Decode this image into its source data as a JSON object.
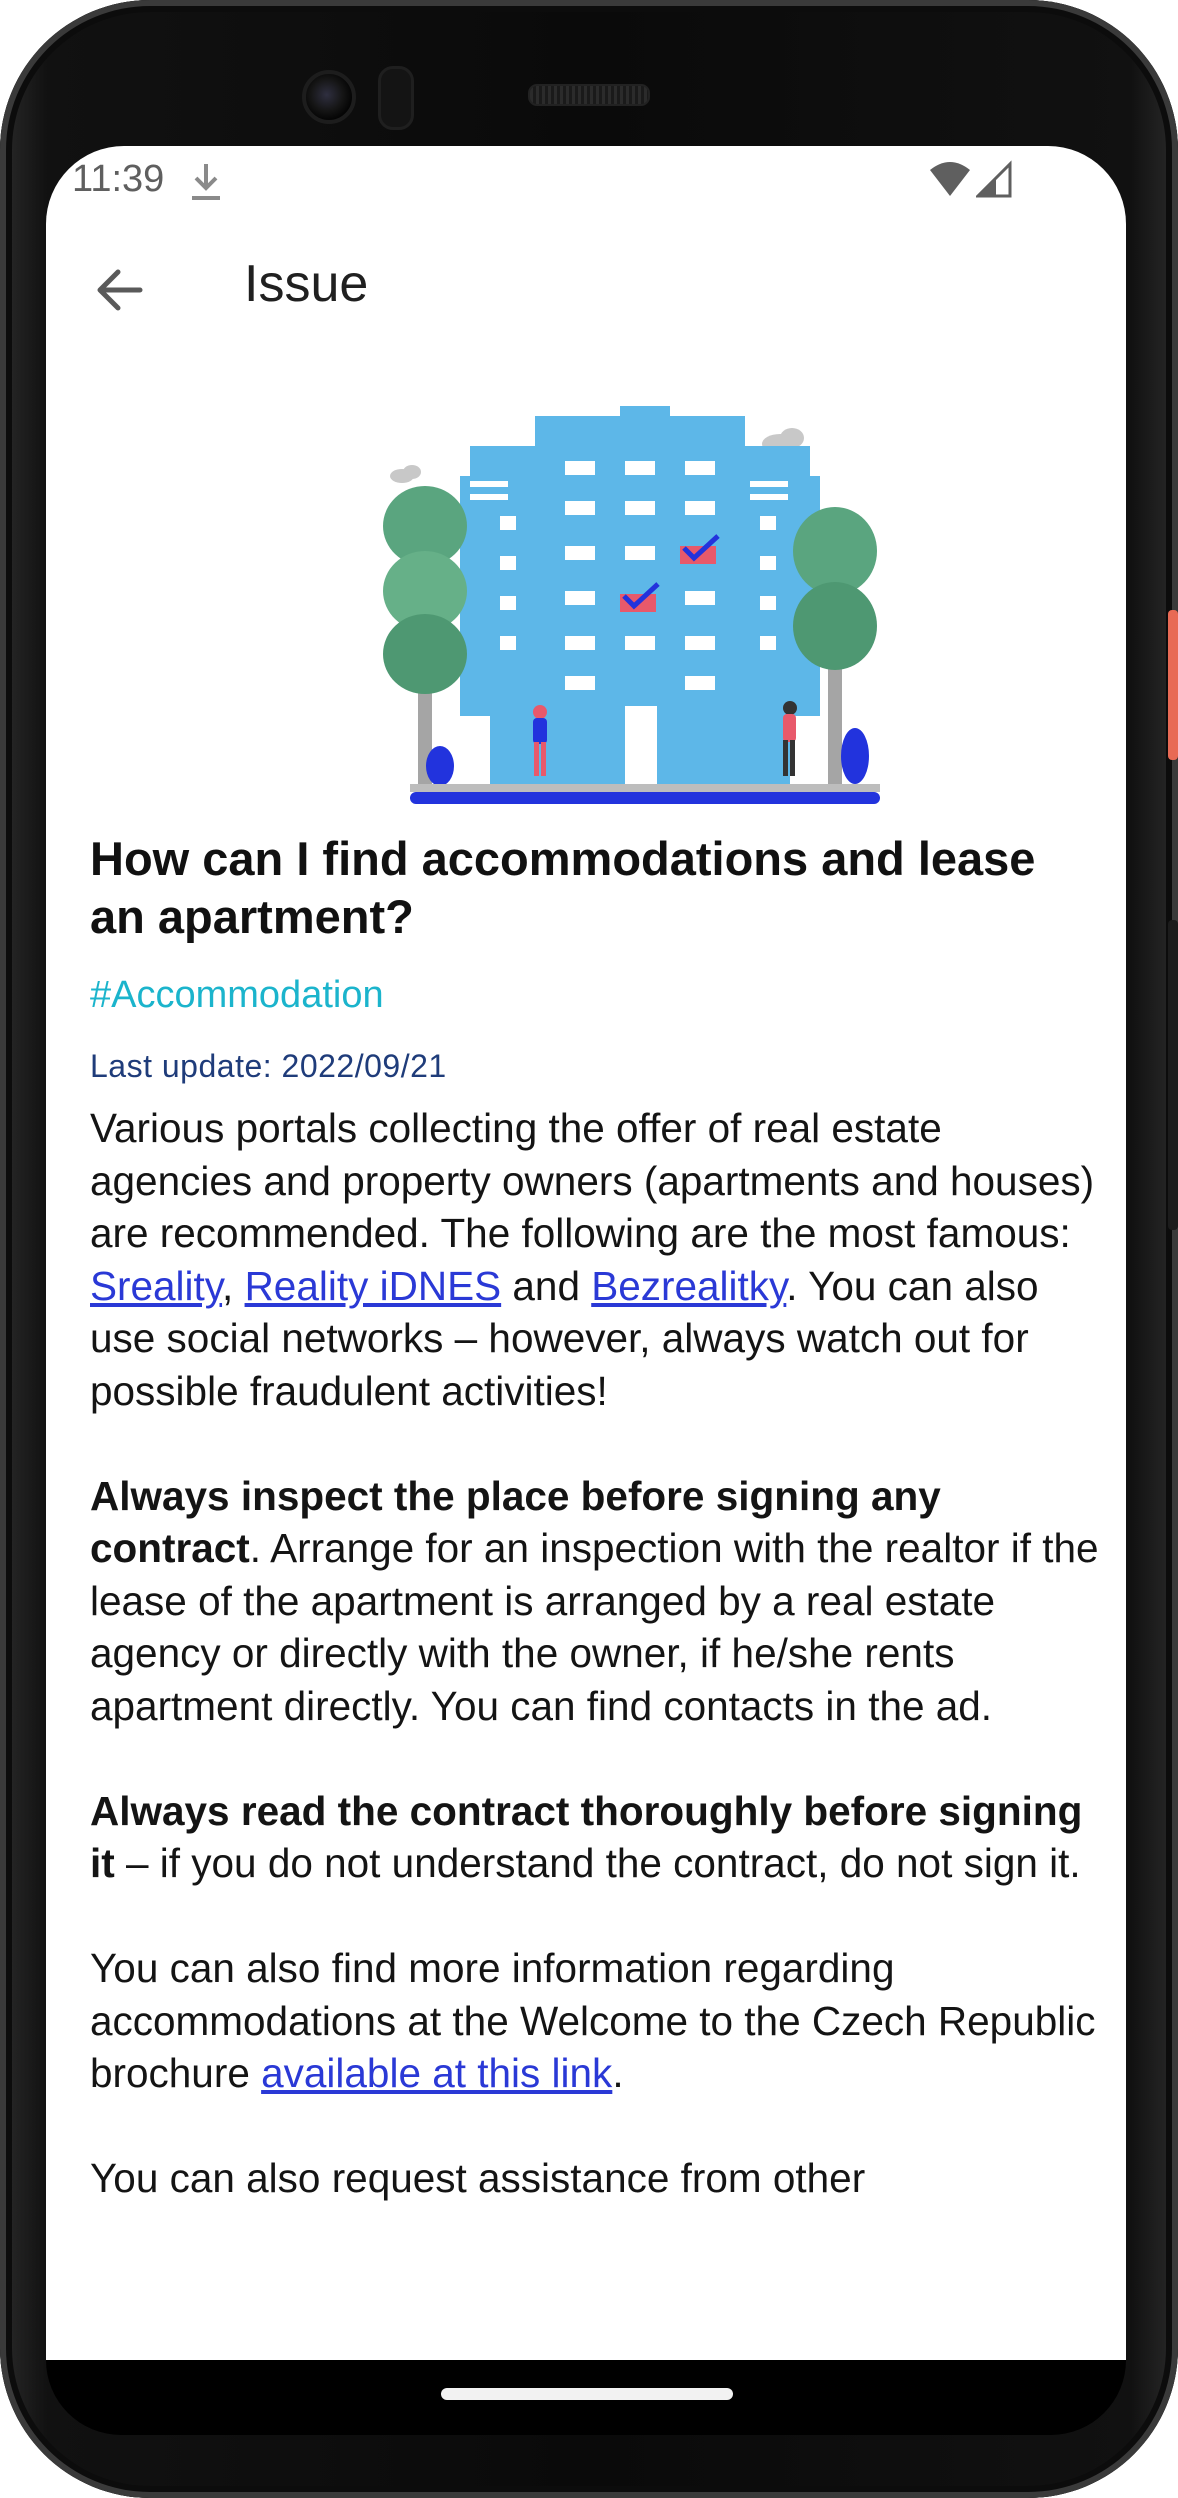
{
  "status_bar": {
    "time": "11:39",
    "download_icon": "download-icon",
    "wifi_icon": "wifi-icon",
    "signal_icon": "signal-icon"
  },
  "app_bar": {
    "back_icon": "arrow-left-icon",
    "title": "Issue"
  },
  "article": {
    "title": "How can I find accommodations and lease an apartment?",
    "tag": "#Accommodation",
    "last_update": "Last update: 2022/09/21",
    "p1": {
      "t1": "Various portals collecting the offer of real estate agencies and property owners (apartments and houses) are recommended. The following are the most famous: ",
      "link1": "Sreality",
      "t2": ", ",
      "link2": "Reality iDNES",
      "t3": " and ",
      "link3": "Bezrealitky",
      "t4": ". You can also use social networks – however, always watch out for possible fraudulent activities!"
    },
    "p2": {
      "bold": "Always inspect the place before signing any contract",
      "text": ". Arrange for an inspection with the realtor if the lease of the apartment is arranged by a real estate agency or directly with the owner, if he/she rents apartment directly. You can find contacts in the ad."
    },
    "p3": {
      "bold": "Always read the contract thoroughly before signing it",
      "text": " – if you do not understand the contract, do not sign it."
    },
    "p4": {
      "text": "You can also find more information regarding accommodations at the Welcome to the Czech Republic brochure ",
      "link": "available at this link",
      "end": "."
    },
    "p5": {
      "text": "You can also request assistance from other"
    }
  },
  "colors": {
    "tag": "#1bb4cc",
    "link": "#2a39d6",
    "building": "#5db7e8",
    "tree": "#5aa57f",
    "accent_blue": "#2233dd",
    "accent_red": "#e8596b"
  }
}
